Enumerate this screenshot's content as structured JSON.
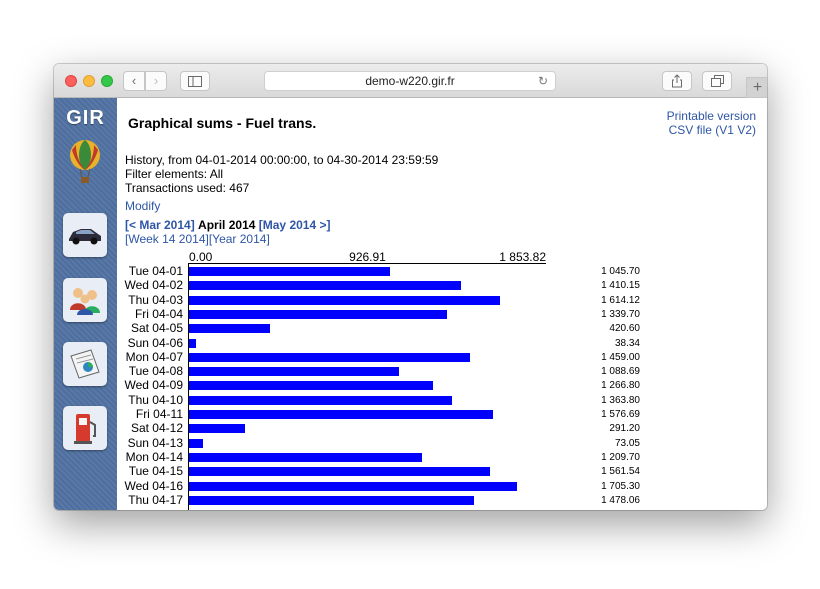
{
  "browser": {
    "url": "demo-w220.gir.fr",
    "new_tab_symbol": "+"
  },
  "sidebar": {
    "logo": "GIR",
    "icons": [
      "hot-air-balloon-icon",
      "car-icon",
      "users-icon",
      "report-icon",
      "fuel-pump-icon"
    ]
  },
  "page": {
    "title": "Graphical sums - Fuel trans.",
    "printable_link": "Printable version",
    "csv_prefix": "CSV file (",
    "csv_v1": "V1",
    "csv_v2": "V2",
    "csv_suffix": ")",
    "history": "History, from 04-01-2014 00:00:00, to 04-30-2014 23:59:59",
    "filter": "Filter elements: All",
    "transactions": "Transactions used: 467",
    "modify": "Modify",
    "prev_month": "[< Mar 2014]",
    "current_month": "April 2014",
    "next_month": "[May 2014 >]",
    "week_link": "[Week 14 2014]",
    "year_link": "[Year 2014]"
  },
  "colors": {
    "bar": "#0000ff",
    "link": "#2e56a6"
  },
  "chart_data": {
    "type": "bar",
    "orientation": "horizontal",
    "scale_labels": [
      "0.00",
      "926.91",
      "1 853.82"
    ],
    "xlim": [
      0,
      1853.82
    ],
    "categories": [
      "Tue 04-01",
      "Wed 04-02",
      "Thu 04-03",
      "Fri 04-04",
      "Sat 04-05",
      "Sun 04-06",
      "Mon 04-07",
      "Tue 04-08",
      "Wed 04-09",
      "Thu 04-10",
      "Fri 04-11",
      "Sat 04-12",
      "Sun 04-13",
      "Mon 04-14",
      "Tue 04-15",
      "Wed 04-16",
      "Thu 04-17"
    ],
    "values": [
      1045.7,
      1410.15,
      1614.12,
      1339.7,
      420.6,
      38.34,
      1459.0,
      1088.69,
      1266.8,
      1363.8,
      1576.69,
      291.2,
      73.05,
      1209.7,
      1561.54,
      1705.3,
      1478.06
    ],
    "value_labels": [
      "1 045.70",
      "1 410.15",
      "1 614.12",
      "1 339.70",
      "420.60",
      "38.34",
      "1 459.00",
      "1 088.69",
      "1 266.80",
      "1 363.80",
      "1 576.69",
      "291.20",
      "73.05",
      "1 209.70",
      "1 561.54",
      "1 705.30",
      "1 478.06"
    ]
  }
}
